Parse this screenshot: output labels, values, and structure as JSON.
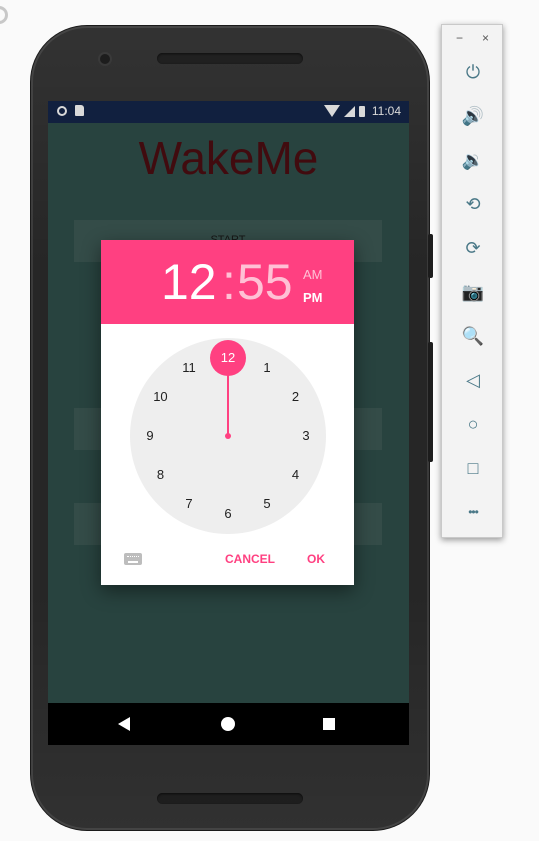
{
  "app": {
    "title": "WakeMe",
    "start_button": "START"
  },
  "status_bar": {
    "time": "11:04"
  },
  "time_picker": {
    "hour": "12",
    "separator": ":",
    "minute": "55",
    "am_label": "AM",
    "pm_label": "PM",
    "selected_period": "PM",
    "selected_hour": "12",
    "dial_numbers": [
      "12",
      "1",
      "2",
      "3",
      "4",
      "5",
      "6",
      "7",
      "8",
      "9",
      "10",
      "11"
    ],
    "cancel_label": "CANCEL",
    "ok_label": "OK"
  },
  "emulator_toolbar": {
    "minimize_label": "−",
    "close_label": "×",
    "items": [
      {
        "icon": "power-icon",
        "glyph": "⏻"
      },
      {
        "icon": "volume-up-icon",
        "glyph": "🔊"
      },
      {
        "icon": "volume-down-icon",
        "glyph": "🔉"
      },
      {
        "icon": "rotate-left-icon",
        "glyph": "⟲"
      },
      {
        "icon": "rotate-right-icon",
        "glyph": "⟳"
      },
      {
        "icon": "camera-icon",
        "glyph": "📷"
      },
      {
        "icon": "zoom-icon",
        "glyph": "🔍"
      },
      {
        "icon": "back-icon",
        "glyph": "◁"
      },
      {
        "icon": "home-icon",
        "glyph": "○"
      },
      {
        "icon": "overview-icon",
        "glyph": "□"
      },
      {
        "icon": "more-icon",
        "glyph": "•••"
      }
    ]
  },
  "colors": {
    "accent": "#ff4081",
    "app_background": "#2f4f4a",
    "title_color": "#4d0e12",
    "status_bar": "#15264a"
  }
}
